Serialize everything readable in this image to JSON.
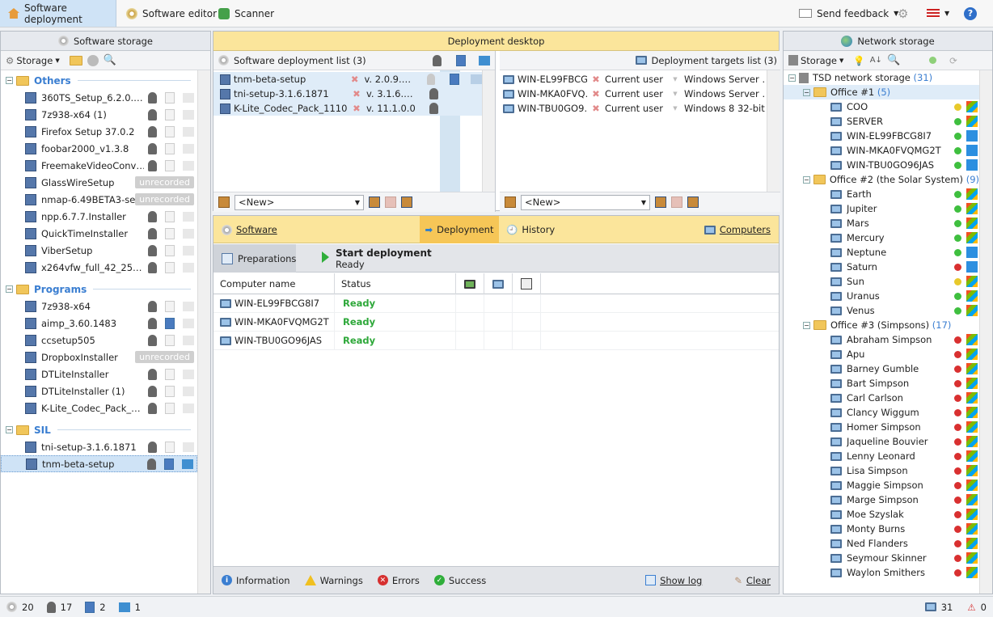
{
  "toolbar": {
    "tabs": [
      {
        "label": "Software deployment"
      },
      {
        "label": "Software editor"
      },
      {
        "label": "Scanner"
      }
    ],
    "send_feedback": "Send feedback"
  },
  "storage": {
    "title": "Software storage",
    "menu": "Storage",
    "groups": [
      {
        "name": "Others",
        "items": [
          {
            "name": "360TS_Setup_6.2.0.…"
          },
          {
            "name": "7z938-x64 (1)"
          },
          {
            "name": "Firefox Setup 37.0.2"
          },
          {
            "name": "foobar2000_v1.3.8"
          },
          {
            "name": "FreemakeVideoConv…"
          },
          {
            "name": "GlassWireSetup",
            "badge": "unrecorded"
          },
          {
            "name": "nmap-6.49BETA3-se…",
            "badge": "unrecorded"
          },
          {
            "name": "npp.6.7.7.Installer"
          },
          {
            "name": "QuickTimeInstaller"
          },
          {
            "name": "ViberSetup"
          },
          {
            "name": "x264vfw_full_42_25…"
          }
        ]
      },
      {
        "name": "Programs",
        "items": [
          {
            "name": "7z938-x64"
          },
          {
            "name": "aimp_3.60.1483"
          },
          {
            "name": "ccsetup505"
          },
          {
            "name": "DropboxInstaller",
            "badge": "unrecorded"
          },
          {
            "name": "DTLiteInstaller"
          },
          {
            "name": "DTLiteInstaller (1)"
          },
          {
            "name": "K-Lite_Codec_Pack_…"
          }
        ]
      },
      {
        "name": "SIL",
        "items": [
          {
            "name": "tni-setup-3.1.6.1871"
          },
          {
            "name": "tnm-beta-setup"
          }
        ]
      }
    ]
  },
  "desktop": {
    "title": "Deployment desktop",
    "sw_list": {
      "title": "Software deployment list (3)",
      "items": [
        {
          "name": "tnm-beta-setup",
          "ver": "v. 2.0.9.…"
        },
        {
          "name": "tni-setup-3.1.6.1871",
          "ver": "v. 3.1.6.…"
        },
        {
          "name": "K-Lite_Codec_Pack_1110…",
          "ver": "v. 11.1.0.0"
        }
      ],
      "new_label": "<New>"
    },
    "targets": {
      "title": "Deployment targets list (3)",
      "items": [
        {
          "name": "WIN-EL99FBCG…",
          "user": "Current user",
          "os": "Windows Server …"
        },
        {
          "name": "WIN-MKA0FVQ…",
          "user": "Current user",
          "os": "Windows Server …"
        },
        {
          "name": "WIN-TBU0GO9…",
          "user": "Current user",
          "os": "Windows 8 32-bit"
        }
      ],
      "new_label": "<New>"
    }
  },
  "deploy": {
    "tabs": {
      "software": "Software",
      "deployment": "Deployment",
      "history": "History",
      "computers": "Computers"
    },
    "preparations": "Preparations",
    "start_title": "Start deployment",
    "start_status": "Ready",
    "columns": {
      "computer": "Computer name",
      "status": "Status"
    },
    "rows": [
      {
        "name": "WIN-EL99FBCG8I7",
        "status": "Ready"
      },
      {
        "name": "WIN-MKA0FVQMG2T",
        "status": "Ready"
      },
      {
        "name": "WIN-TBU0GO96JAS",
        "status": "Ready"
      }
    ],
    "footer": {
      "information": "Information",
      "warnings": "Warnings",
      "errors": "Errors",
      "success": "Success",
      "show_log": "Show log",
      "clear": "Clear"
    }
  },
  "network": {
    "title": "Network storage",
    "menu": "Storage",
    "root": "TSD network storage",
    "root_count": "(31)",
    "offices": [
      {
        "name": "Office #1",
        "count": "(5)",
        "items": [
          {
            "name": "COO",
            "status": "#e8c92a",
            "os": "win"
          },
          {
            "name": "SERVER",
            "status": "#3fbf3f",
            "os": "win"
          },
          {
            "name": "WIN-EL99FBCG8I7",
            "status": "#3fbf3f",
            "os": "winb"
          },
          {
            "name": "WIN-MKA0FVQMG2T",
            "status": "#3fbf3f",
            "os": "winb"
          },
          {
            "name": "WIN-TBU0GO96JAS",
            "status": "#3fbf3f",
            "os": "winb"
          }
        ]
      },
      {
        "name": "Office #2 (the Solar System)",
        "count": "(9)",
        "items": [
          {
            "name": "Earth",
            "status": "#3fbf3f",
            "os": "win"
          },
          {
            "name": "Jupiter",
            "status": "#3fbf3f",
            "os": "win"
          },
          {
            "name": "Mars",
            "status": "#3fbf3f",
            "os": "win"
          },
          {
            "name": "Mercury",
            "status": "#3fbf3f",
            "os": "win"
          },
          {
            "name": "Neptune",
            "status": "#3fbf3f",
            "os": "winb"
          },
          {
            "name": "Saturn",
            "status": "#d93030",
            "os": "winb"
          },
          {
            "name": "Sun",
            "status": "#e8c92a",
            "os": "win"
          },
          {
            "name": "Uranus",
            "status": "#3fbf3f",
            "os": "win"
          },
          {
            "name": "Venus",
            "status": "#3fbf3f",
            "os": "win"
          }
        ]
      },
      {
        "name": "Office #3 (Simpsons)",
        "count": "(17)",
        "items": [
          {
            "name": "Abraham Simpson",
            "status": "#d93030",
            "os": "win"
          },
          {
            "name": "Apu",
            "status": "#d93030",
            "os": "win"
          },
          {
            "name": "Barney Gumble",
            "status": "#d93030",
            "os": "win"
          },
          {
            "name": "Bart Simpson",
            "status": "#d93030",
            "os": "win"
          },
          {
            "name": "Carl Carlson",
            "status": "#d93030",
            "os": "win"
          },
          {
            "name": "Clancy Wiggum",
            "status": "#d93030",
            "os": "win"
          },
          {
            "name": "Homer Simpson",
            "status": "#d93030",
            "os": "win"
          },
          {
            "name": "Jaqueline Bouvier",
            "status": "#d93030",
            "os": "win"
          },
          {
            "name": "Lenny Leonard",
            "status": "#d93030",
            "os": "win"
          },
          {
            "name": "Lisa Simpson",
            "status": "#d93030",
            "os": "win"
          },
          {
            "name": "Maggie Simpson",
            "status": "#d93030",
            "os": "win"
          },
          {
            "name": "Marge Simpson",
            "status": "#d93030",
            "os": "win"
          },
          {
            "name": "Moe Szyslak",
            "status": "#d93030",
            "os": "win"
          },
          {
            "name": "Monty Burns",
            "status": "#d93030",
            "os": "win"
          },
          {
            "name": "Ned Flanders",
            "status": "#d93030",
            "os": "win"
          },
          {
            "name": "Seymour Skinner",
            "status": "#d93030",
            "os": "win"
          },
          {
            "name": "Waylon Smithers",
            "status": "#d93030",
            "os": "win"
          }
        ]
      }
    ]
  },
  "statusbar": {
    "packages": "20",
    "ghost": "17",
    "film": "2",
    "stack": "1",
    "computers": "31",
    "errors": "0"
  }
}
